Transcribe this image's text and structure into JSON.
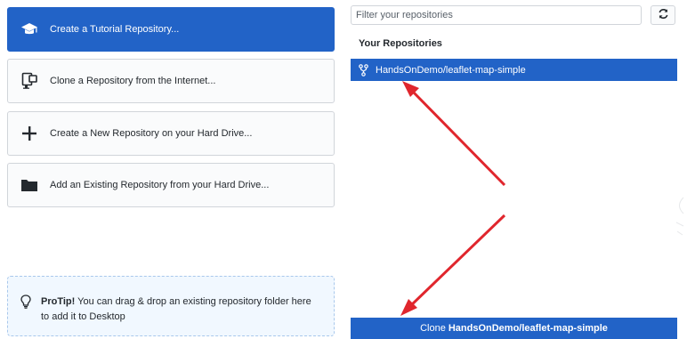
{
  "actions": [
    {
      "label": "Create a Tutorial Repository...",
      "icon": "graduation-cap-icon"
    },
    {
      "label": "Clone a Repository from the Internet...",
      "icon": "device-desktop-icon"
    },
    {
      "label": "Create a New Repository on your Hard Drive...",
      "icon": "plus-icon"
    },
    {
      "label": "Add an Existing Repository from your Hard Drive...",
      "icon": "folder-icon"
    }
  ],
  "protip": {
    "bold": "ProTip!",
    "text": "You can drag & drop an existing repository folder here to add it to Desktop",
    "icon": "light-bulb-icon"
  },
  "filter": {
    "placeholder": "Filter your repositories",
    "value": ""
  },
  "repos": {
    "section_title": "Your Repositories",
    "items": [
      {
        "name": "HandsOnDemo/leaflet-map-simple",
        "icon": "repo-forked-icon"
      }
    ]
  },
  "clone_button": {
    "prefix": "Clone",
    "repo": "HandsOnDemo/leaflet-map-simple"
  },
  "colors": {
    "accent": "#2263c7",
    "arrow": "#e0262d",
    "protip_bg": "#f1f8ff"
  }
}
